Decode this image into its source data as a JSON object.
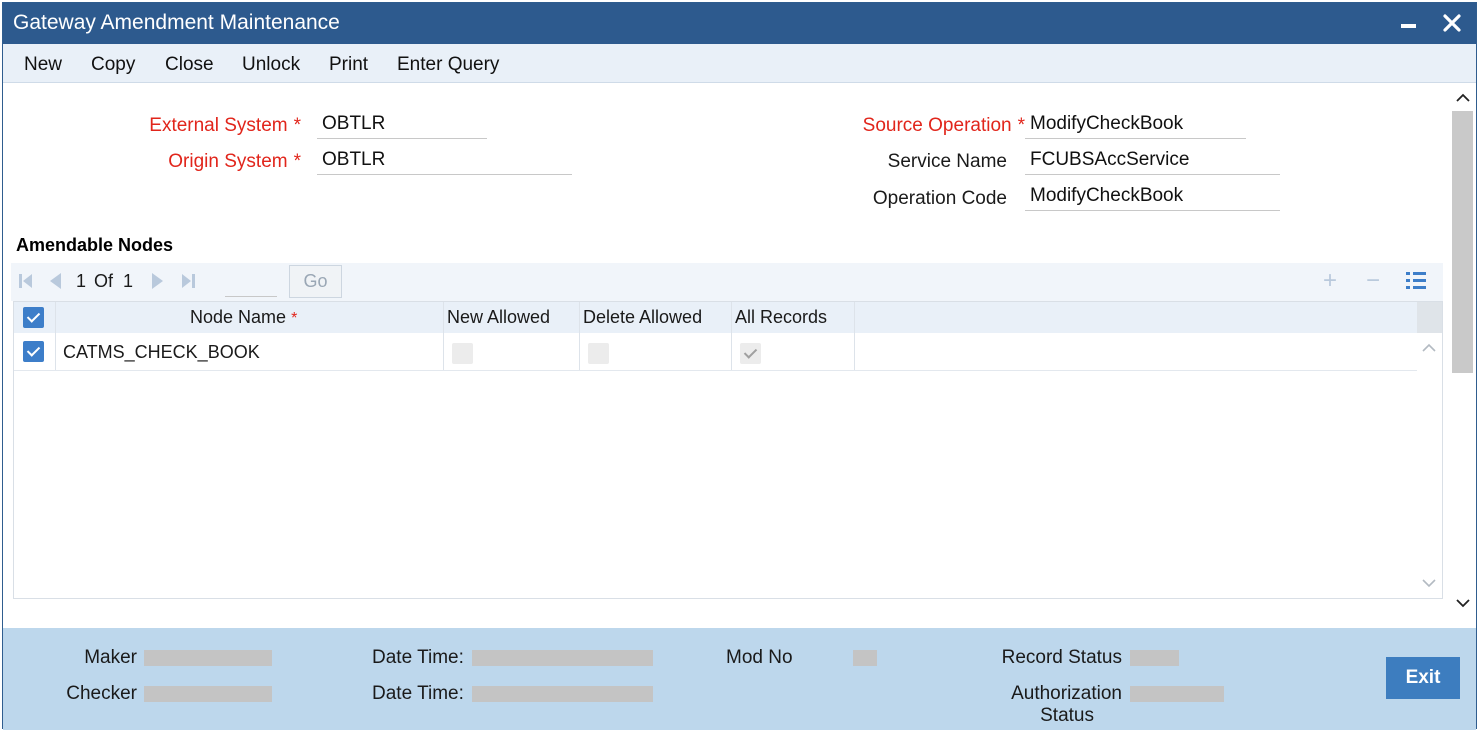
{
  "window": {
    "title": "Gateway Amendment Maintenance",
    "minimize_label": "minimize",
    "close_label": "close"
  },
  "menu": {
    "items": [
      {
        "label": "New"
      },
      {
        "label": "Copy"
      },
      {
        "label": "Close"
      },
      {
        "label": "Unlock"
      },
      {
        "label": "Print"
      },
      {
        "label": "Enter Query"
      }
    ]
  },
  "form": {
    "external_system": {
      "label": "External System",
      "value": "OBTLR",
      "required": true
    },
    "origin_system": {
      "label": "Origin System",
      "value": "OBTLR",
      "required": true
    },
    "source_operation": {
      "label": "Source Operation",
      "value": "ModifyCheckBook",
      "required": true
    },
    "service_name": {
      "label": "Service Name",
      "value": "FCUBSAccService",
      "required": false
    },
    "operation_code": {
      "label": "Operation Code",
      "value": "ModifyCheckBook",
      "required": false
    },
    "required_marker": "*"
  },
  "amendable_nodes": {
    "title": "Amendable Nodes",
    "pager": {
      "current": "1",
      "of_label": "Of",
      "total": "1",
      "go_label": "Go",
      "add_icon": "+",
      "remove_icon": "−"
    },
    "columns": [
      "Node Name",
      "New Allowed",
      "Delete Allowed",
      "All Records"
    ],
    "required_marker": "*",
    "select_all": true,
    "rows": [
      {
        "selected": true,
        "node_name": "CATMS_CHECK_BOOK",
        "new_allowed": false,
        "delete_allowed": false,
        "all_records": true
      }
    ]
  },
  "footer": {
    "maker_label": "Maker",
    "checker_label": "Checker",
    "datetime_label": "Date Time:",
    "mod_no_label": "Mod No",
    "record_status_label": "Record Status",
    "authorization_status_label_1": "Authorization",
    "authorization_status_label_2": "Status",
    "exit_label": "Exit"
  },
  "colors": {
    "title_bar": "#2d5a8e",
    "menu_bar": "#e9f0f8",
    "required_text": "#e1251b",
    "accent": "#3d7ec9",
    "footer": "#bdd7ec"
  }
}
